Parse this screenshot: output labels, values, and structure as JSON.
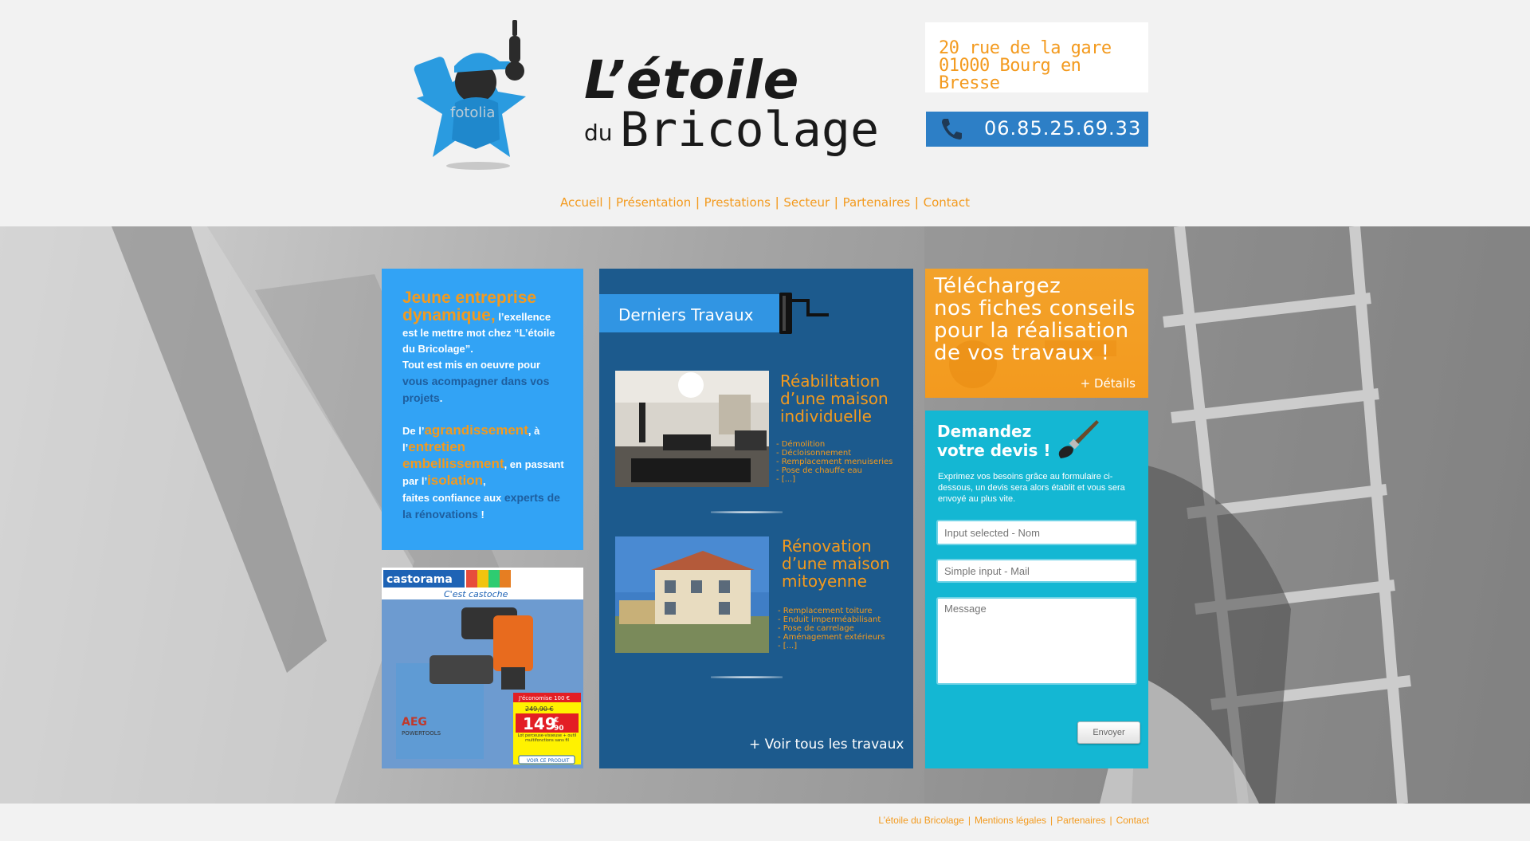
{
  "header": {
    "logo_title_1": "L’étoile",
    "logo_du": "du",
    "logo_title_2": "Bricolage",
    "mascot_watermark": "fotolia",
    "address_line_1": "20 rue de la gare",
    "address_line_2": "01000 Bourg en Bresse",
    "phone": "06.85.25.69.33",
    "phone_icon": "phone-icon"
  },
  "nav": {
    "items": [
      {
        "label": "Accueil"
      },
      {
        "label": "Présentation"
      },
      {
        "label": "Prestations"
      },
      {
        "label": "Secteur"
      },
      {
        "label": "Partenaires"
      },
      {
        "label": "Contact"
      }
    ],
    "separator": "|"
  },
  "intro": {
    "p1_big": "Jeune entreprise dynamique,",
    "p1_rest": " l’exellence est le mettre mot chez “L’étoile du Bricolage”.",
    "p2_a": "Tout est mis en oeuvre pour ",
    "p2_dark": "vous acompagner dans vos projets",
    "p2_end": ".",
    "p3_a": "De l’",
    "p3_o1": "agrandissement",
    "p3_b": ", à l’",
    "p3_o2": "entretien embellissement",
    "p3_c": ", en passant par l’",
    "p3_o3": "isolation",
    "p3_d": ",",
    "p3_e": "faites confiance aux ",
    "p3_dark": "experts de la rénovations",
    "p3_end": " !"
  },
  "ad": {
    "brand": "castorama",
    "slogan": "C'est castoche",
    "product_brand": "AEG",
    "product_sub": "POWERTOOLS",
    "saving": "J'économise 100 €",
    "old_price": "249,90 €",
    "price_main": "149",
    "price_cents": "90",
    "price_currency": "€",
    "desc": "Lot perceuse-visseuse + outil multifonctions sans fil",
    "cta": "VOIR CE PRODUIT"
  },
  "works": {
    "title": "Derniers Travaux",
    "items": [
      {
        "title_lines": [
          "Réabilitation",
          "d’une maison",
          "individuelle"
        ],
        "list": [
          "- Démolition",
          "- Décloisonnement",
          "- Remplacement menuiseries",
          "- Pose de chauffe eau",
          "- [...]"
        ]
      },
      {
        "title_lines": [
          "Rénovation",
          "d’une maison",
          "mitoyenne"
        ],
        "list": [
          "- Remplacement toiture",
          "- Enduit imperméabilisant",
          "- Pose de carrelage",
          "- Aménagement extérieurs",
          "- [...]"
        ]
      }
    ],
    "see_all": "+ Voir tous les travaux"
  },
  "download": {
    "lines": [
      "Téléchargez",
      "nos fiches conseils",
      "pour la réalisation",
      "de vos travaux !"
    ],
    "details": "+ Détails"
  },
  "quote": {
    "title_1": "Demandez",
    "title_2": "votre devis !",
    "desc": "Exprimez vos besoins grâce au formulaire ci-dessous, un devis sera alors établit et vous sera envoyé au plus vite.",
    "name_placeholder": "Input selected - Nom",
    "mail_placeholder": "Simple input - Mail",
    "message_placeholder": "Message",
    "send_label": "Envoyer"
  },
  "footer": {
    "links": [
      "L’étoile du Bricolage",
      "Mentions légales",
      "Partenaires",
      "Contact"
    ],
    "separator": "|"
  },
  "colors": {
    "accent_orange": "#f39a1e",
    "blue": "#32a3f5",
    "dark_blue": "#1c5a8d",
    "cyan": "#14b7d3",
    "phone_blue": "#2d7fc6"
  }
}
